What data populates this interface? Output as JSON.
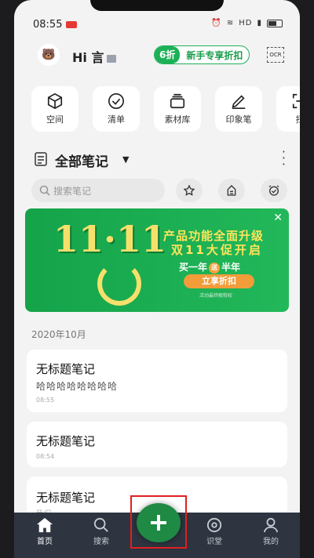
{
  "status": {
    "time": "08:55",
    "network": "HD"
  },
  "header": {
    "greeting": "Hi 言",
    "promo_discount": "6折",
    "promo_text": "新手专享折扣",
    "ocr_label": "OCR"
  },
  "quick": [
    {
      "label": "空间",
      "icon": "cube-icon"
    },
    {
      "label": "清单",
      "icon": "check-circle-icon"
    },
    {
      "label": "素材库",
      "icon": "stack-icon"
    },
    {
      "label": "印象笔",
      "icon": "pen-icon"
    },
    {
      "label": "扫",
      "icon": "scan-icon"
    }
  ],
  "notes_header": {
    "title": "全部笔记"
  },
  "search": {
    "placeholder": "搜索笔记"
  },
  "banner": {
    "big_text": "11·11",
    "line1": "产品功能全面升级",
    "line2": "双11大促开启",
    "line3a": "买一年",
    "line3_badge": "送",
    "line3b": "半年",
    "cta": "立享折扣",
    "fine": "活动最终解释权"
  },
  "section": {
    "month": "2020年10月"
  },
  "notes": [
    {
      "title": "无标题笔记",
      "snippet": "哈哈哈哈哈哈哈哈",
      "time": "08:55"
    },
    {
      "title": "无标题笔记",
      "snippet": "",
      "time": "08:54"
    },
    {
      "title": "无标题笔记",
      "snippet": "我们",
      "time": ""
    }
  ],
  "tabs": [
    {
      "label": "首页",
      "icon": "home-icon",
      "active": true
    },
    {
      "label": "搜索",
      "icon": "search-icon"
    },
    {
      "label": "识堂",
      "icon": "compass-icon"
    },
    {
      "label": "我的",
      "icon": "person-icon"
    }
  ],
  "colors": {
    "brand_green": "#1db057",
    "tabbar": "#2e3440",
    "highlight": "#e02020"
  }
}
